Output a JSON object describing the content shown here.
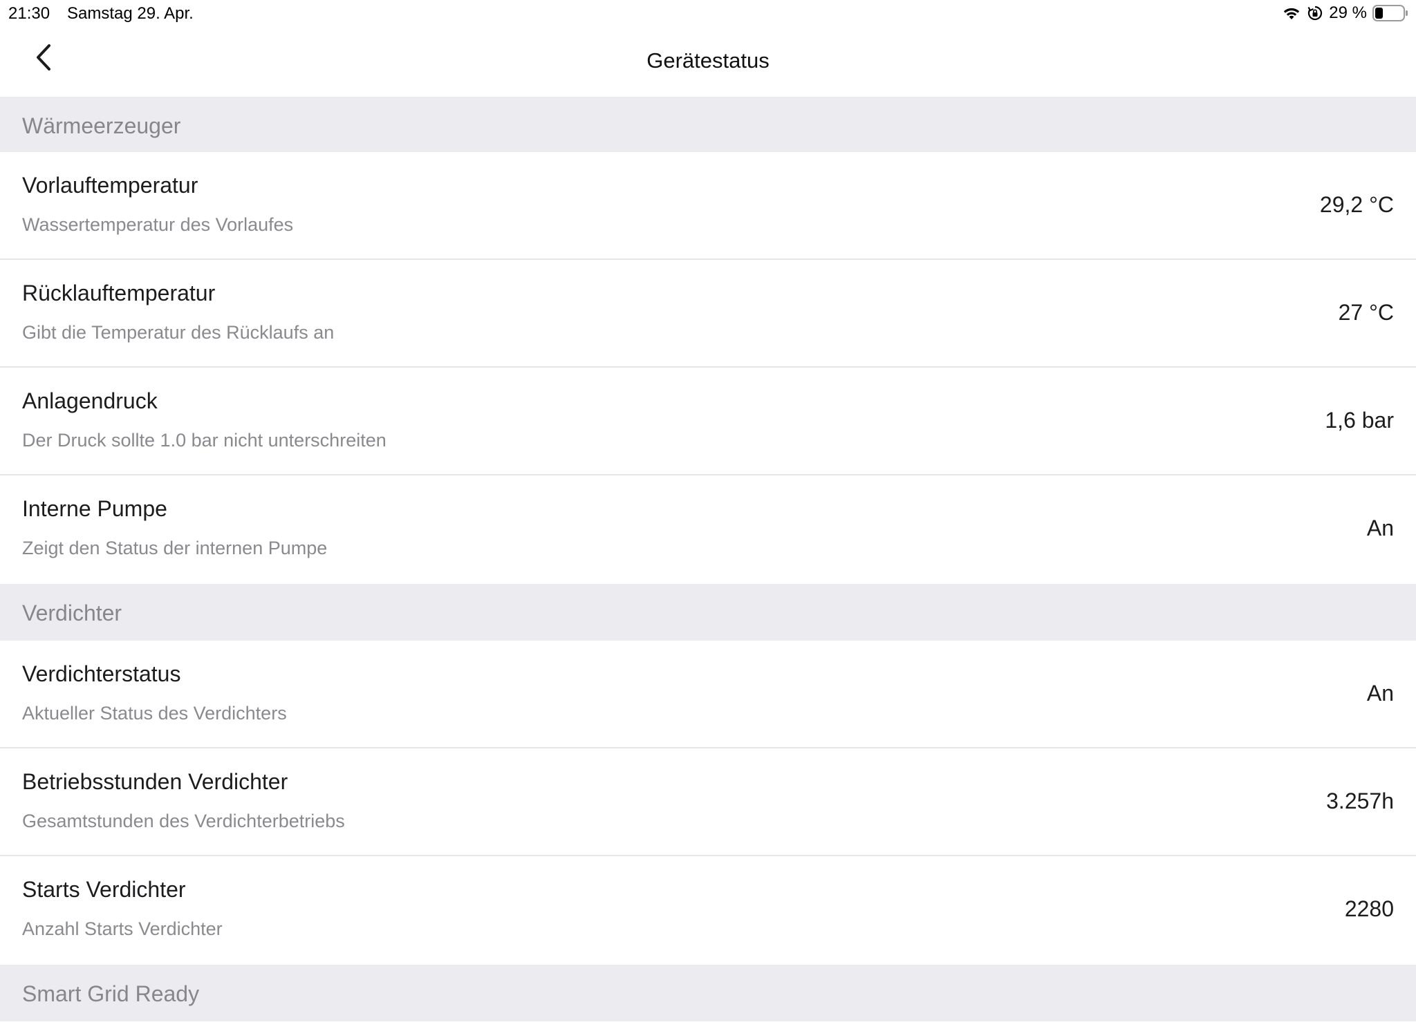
{
  "status_bar": {
    "time": "21:30",
    "date": "Samstag 29. Apr.",
    "battery_percent": "29 %",
    "battery_level": 0.29,
    "icons": [
      "wifi-icon",
      "lock-rotation-icon",
      "battery-icon"
    ]
  },
  "nav": {
    "title": "Gerätestatus",
    "back_icon": "chevron-left-icon"
  },
  "sections": [
    {
      "header": "Wärmeerzeuger",
      "rows": [
        {
          "title": "Vorlauftemperatur",
          "subtitle": "Wassertemperatur des Vorlaufes",
          "value": "29,2 °C"
        },
        {
          "title": "Rücklauftemperatur",
          "subtitle": "Gibt die Temperatur des Rücklaufs an",
          "value": "27 °C"
        },
        {
          "title": "Anlagendruck",
          "subtitle": "Der Druck sollte 1.0 bar nicht unterschreiten",
          "value": "1,6 bar"
        },
        {
          "title": "Interne Pumpe",
          "subtitle": "Zeigt den Status der internen Pumpe",
          "value": "An"
        }
      ]
    },
    {
      "header": "Verdichter",
      "rows": [
        {
          "title": "Verdichterstatus",
          "subtitle": "Aktueller Status des Verdichters",
          "value": "An"
        },
        {
          "title": "Betriebsstunden Verdichter",
          "subtitle": "Gesamtstunden des Verdichterbetriebs",
          "value": "3.257h"
        },
        {
          "title": "Starts Verdichter",
          "subtitle": "Anzahl Starts Verdichter",
          "value": "2280"
        }
      ]
    },
    {
      "header": "Smart Grid Ready",
      "rows": []
    }
  ],
  "colors": {
    "section_background": "#ebebf0",
    "section_text": "#86868b",
    "subtitle_text": "#8a8a8e",
    "separator": "#e5e5ea"
  }
}
